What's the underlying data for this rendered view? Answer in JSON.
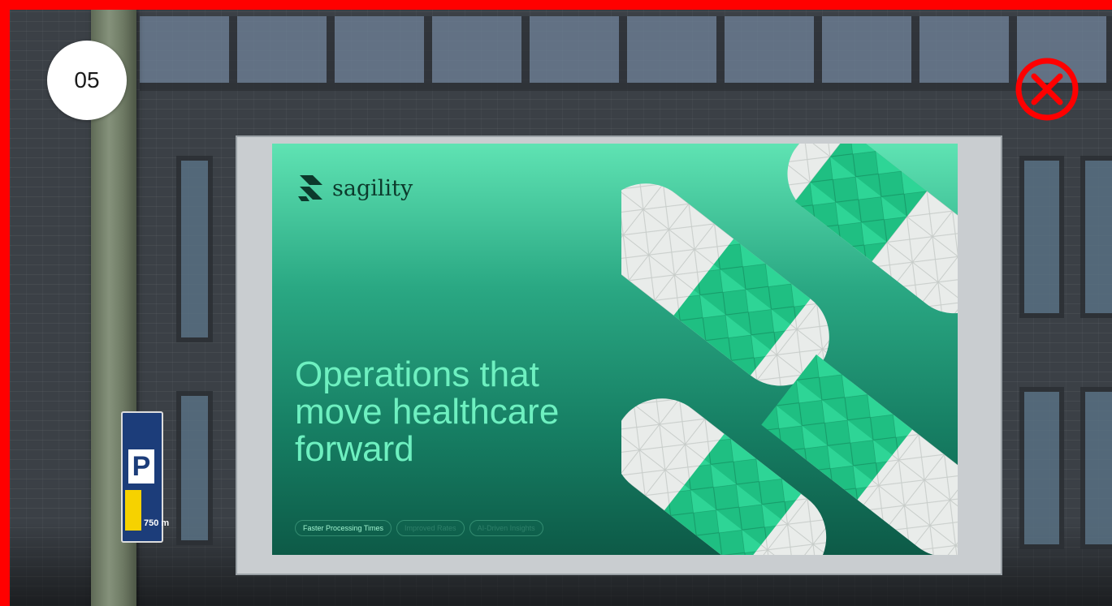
{
  "slide": {
    "number": "05"
  },
  "billboard": {
    "brand_name": "sagility",
    "headline_lines": [
      "Operations that",
      "move healthcare",
      "forward"
    ],
    "pills": [
      "Faster Processing Times",
      "Improved Rates",
      "AI-Driven Insights"
    ]
  },
  "street_sign": {
    "letter": "P",
    "distance": "750 m"
  },
  "colors": {
    "frame": "#ff0000",
    "close": "#ff0000",
    "brand_green": "#2aa883",
    "headline": "#6ef0c0"
  },
  "icons": {
    "close": "close-icon",
    "logo": "sagility-logo-icon"
  }
}
